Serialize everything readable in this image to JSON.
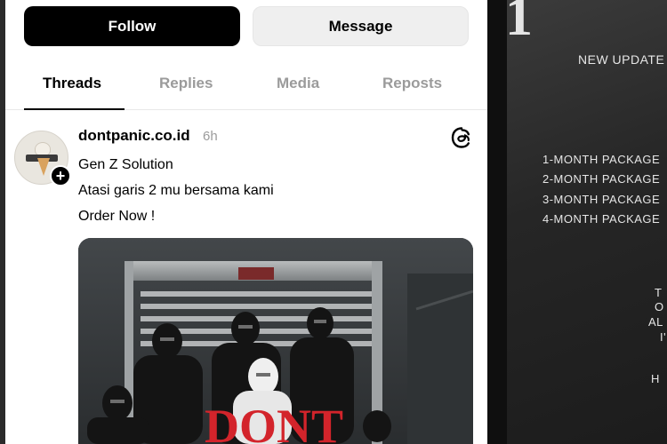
{
  "profile_actions": {
    "follow_label": "Follow",
    "message_label": "Message"
  },
  "tabs": [
    {
      "label": "Threads",
      "active": true
    },
    {
      "label": "Replies",
      "active": false
    },
    {
      "label": "Media",
      "active": false
    },
    {
      "label": "Reposts",
      "active": false
    }
  ],
  "post": {
    "username": "dontpanic.co.id",
    "time": "6h",
    "lines": [
      "Gen Z Solution",
      "Atasi garis 2 mu bersama kami",
      "Order Now !"
    ],
    "image_text": "DONT"
  },
  "poster": {
    "heading_fragment": "1",
    "update_text": "NEW UPDATE",
    "packages": [
      "1-MONTH PACKAGE",
      "2-MONTH PACKAGE",
      "3-MONTH PACKAGE",
      "4-MONTH PACKAGE"
    ],
    "fragments": [
      "T",
      "O",
      "AL",
      "I'",
      "H"
    ]
  },
  "colors": {
    "accent": "#000000",
    "brand_red": "#d3242b",
    "muted": "#9b9b9b"
  }
}
